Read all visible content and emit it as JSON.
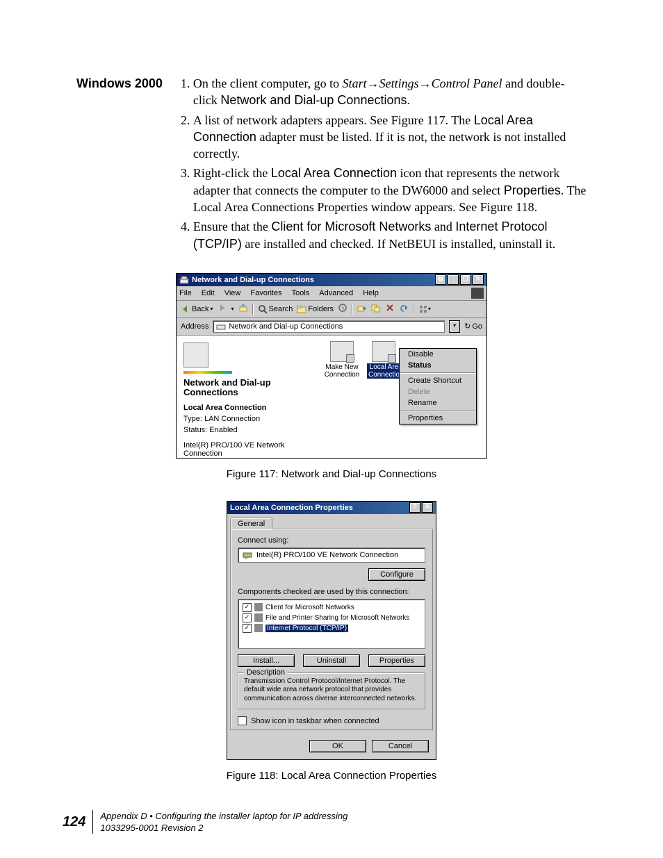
{
  "section_heading": "Windows 2000",
  "steps": {
    "s1_a": "On the client computer, go to ",
    "s1_path1": "Start",
    "s1_path2": "Settings",
    "s1_path3": "Control Panel",
    "s1_b": " and double-click ",
    "s1_c": "Network and Dial-up Connections",
    "s1_d": ".",
    "s2_a": "A list of network adapters appears. See Figure 117. The ",
    "s2_b": "Local Area Connection",
    "s2_c": " adapter must be listed. If it is not, the network is not installed correctly.",
    "s3_a": "Right-click the ",
    "s3_b": "Local Area Connection",
    "s3_c": " icon that represents the network adapter that connects the computer to the DW6000 and select ",
    "s3_d": "Properties",
    "s3_e": ". The Local Area Connections Properties window appears. See Figure 118.",
    "s4_a": "Ensure that the ",
    "s4_b": "Client for Microsoft Networks",
    "s4_c": " and ",
    "s4_d": "Internet Protocol (TCP/IP)",
    "s4_e": " are installed and checked. If NetBEUI is installed, uninstall it."
  },
  "fig117": {
    "title": "Network and Dial-up Connections",
    "menus": [
      "File",
      "Edit",
      "View",
      "Favorites",
      "Tools",
      "Advanced",
      "Help"
    ],
    "toolbar": {
      "back": "Back",
      "search": "Search",
      "folders": "Folders"
    },
    "address_label": "Address",
    "address_value": "Network and Dial-up Connections",
    "go": "Go",
    "left": {
      "heading": "Network and Dial-up Connections",
      "item_title": "Local Area Connection",
      "type": "Type: LAN Connection",
      "status": "Status: Enabled",
      "device": "Intel(R) PRO/100 VE Network Connection"
    },
    "icons": {
      "make_new": "Make New Connection",
      "lac": "Local Area Connection"
    },
    "context": {
      "disable": "Disable",
      "status": "Status",
      "create_shortcut": "Create Shortcut",
      "delete": "Delete",
      "rename": "Rename",
      "properties": "Properties"
    },
    "caption": "Figure 117:  Network and Dial-up Connections"
  },
  "fig118": {
    "title": "Local Area Connection Properties",
    "tab": "General",
    "connect_using": "Connect using:",
    "adapter": "Intel(R) PRO/100 VE Network Connection",
    "configure": "Configure",
    "components_label": "Components checked are used by this connection:",
    "components": {
      "c1": "Client for Microsoft Networks",
      "c2": "File and Printer Sharing for Microsoft Networks",
      "c3": "Internet Protocol (TCP/IP)"
    },
    "install": "Install...",
    "uninstall": "Uninstall",
    "properties": "Properties",
    "description_label": "Description",
    "description": "Transmission Control Protocol/Internet Protocol. The default wide area network protocol that provides communication across diverse interconnected networks.",
    "show_icon": "Show icon in taskbar when connected",
    "ok": "OK",
    "cancel": "Cancel",
    "caption": "Figure 118:  Local Area Connection Properties"
  },
  "footer": {
    "page": "124",
    "line1": "Appendix D • Configuring the installer laptop for IP addressing",
    "line2": "1033295-0001  Revision 2"
  },
  "glyphs": {
    "arrow": "→",
    "check": "✓",
    "tri": "▾",
    "help": "?",
    "close": "✕",
    "min": "_",
    "max": "❐",
    "restore": "⧉",
    "go_arrow": "↻"
  }
}
